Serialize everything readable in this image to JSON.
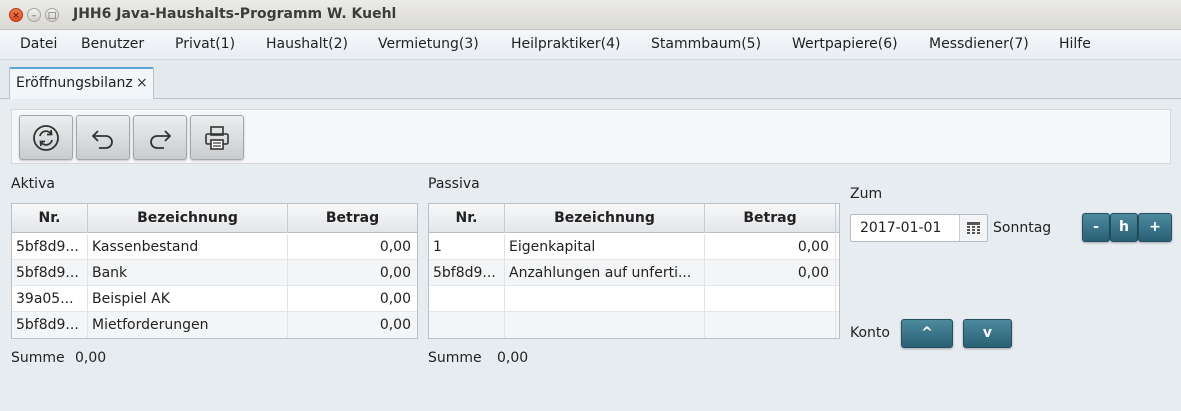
{
  "window": {
    "title": "JHH6 Java-Haushalts-Programm W. Kuehl"
  },
  "menu": [
    "Datei",
    "Benutzer",
    "Privat(1)",
    "Haushalt(2)",
    "Vermietung(3)",
    "Heilpraktiker(4)",
    "Stammbaum(5)",
    "Wertpapiere(6)",
    "Messdiener(7)",
    "Hilfe"
  ],
  "tab": {
    "label": "Eröffnungsbilanz",
    "close": "×"
  },
  "toolbar": {
    "icons": [
      "refresh-icon",
      "undo-icon",
      "redo-icon",
      "print-icon"
    ]
  },
  "aktiva": {
    "label": "Aktiva",
    "columns": [
      "Nr.",
      "Bezeichnung",
      "Betrag"
    ],
    "rows": [
      [
        "5bf8d9...",
        "Kassenbestand",
        "0,00"
      ],
      [
        "5bf8d9...",
        "Bank",
        "0,00"
      ],
      [
        "39a05...",
        "Beispiel AK",
        "0,00"
      ],
      [
        "5bf8d9...",
        "Mietforderungen",
        "0,00"
      ]
    ],
    "sum_label": "Summe",
    "sum_value": "0,00"
  },
  "passiva": {
    "label": "Passiva",
    "columns": [
      "Nr.",
      "Bezeichnung",
      "Betrag"
    ],
    "rows": [
      [
        "1",
        "Eigenkapital",
        "0,00"
      ],
      [
        "5bf8d9...",
        "Anzahlungen auf unferti...",
        "0,00"
      ],
      [
        "",
        "",
        ""
      ],
      [
        "",
        "",
        ""
      ]
    ],
    "sum_label": "Summe",
    "sum_value": "0,00"
  },
  "date": {
    "label": "Zum",
    "value": "2017-01-01",
    "weekday": "Sonntag",
    "minus": "-",
    "today": "h",
    "plus": "+"
  },
  "konto": {
    "label": "Konto",
    "up": "^",
    "down": "v"
  },
  "colors": {
    "accent": "#2a6075",
    "tab_highlight": "#5aa8d8"
  }
}
